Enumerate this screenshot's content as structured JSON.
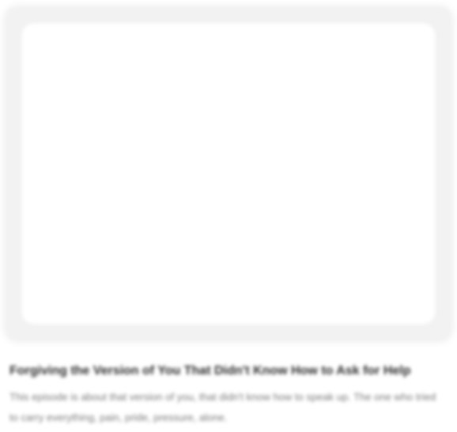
{
  "episode": {
    "title": "Forgiving the Version of You That Didn't Know How to Ask for Help",
    "description": "This episode is about that version of you, that didn't know how to speak up. The one who tried to carry everything, pain, pride, pressure, alone."
  },
  "colors": {
    "card_background": "#f2f2f2",
    "artwork_background": "#ffffff",
    "title_text": "#2a2a2a",
    "description_text": "#7a7a7a"
  }
}
